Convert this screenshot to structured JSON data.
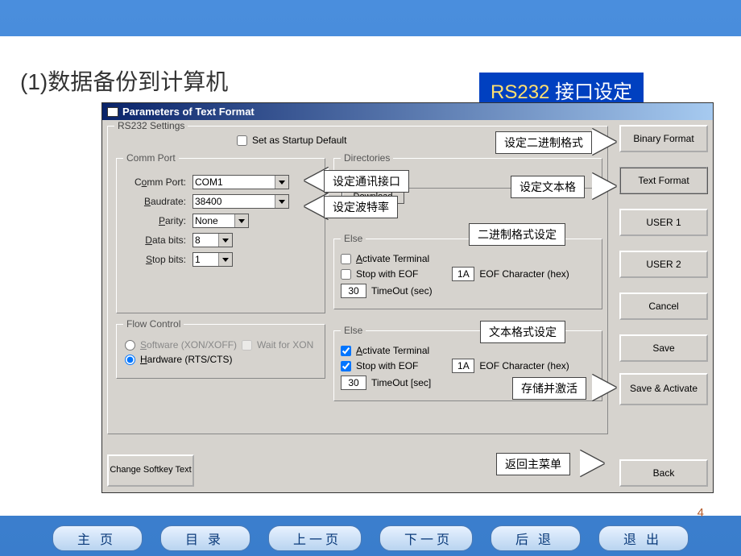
{
  "slide": {
    "title": "(1)数据备份到计算机",
    "badge_prefix": "RS232",
    "badge_suffix": " 接口设定",
    "page_num": "4"
  },
  "dialog": {
    "title": "Parameters of Text Format",
    "startup": "Set  as Startup Default"
  },
  "main_legend": "RS232 Settings",
  "comm": {
    "legend": "Comm Port",
    "port_lbl": "Comm Port:",
    "port": "COM1",
    "baud_lbl": "Baudrate:",
    "baud": "38400",
    "parity_lbl": "Parity:",
    "parity": "None",
    "data_lbl": "Data bits:",
    "data": "8",
    "stop_lbl": "Stop bits:",
    "stop": "1"
  },
  "flow": {
    "legend": "Flow Control",
    "soft": "Software (XON/XOFF)",
    "wait": "Wait for XON",
    "hard": "Hardware (RTS/CTS)"
  },
  "dir": {
    "legend": "Directories",
    "download": "Download"
  },
  "else1": {
    "legend": "Else",
    "act": "Activate Terminal",
    "eof": "Stop with  EOF",
    "hex": "1A",
    "hexlbl": "EOF Character (hex)",
    "to": "30",
    "tolbl": "TimeOut (sec)"
  },
  "else2": {
    "legend": "Else",
    "act": "Activate Terminal",
    "eof": "Stop with  EOF",
    "hex": "1A",
    "hexlbl": "EOF Character (hex)",
    "to": "30",
    "tolbl": "TimeOut [sec]"
  },
  "sidebar": {
    "b1": "Binary Format",
    "b2": "Text Format",
    "b3": "USER 1",
    "b4": "USER 2",
    "b5": "Cancel",
    "b6": "Save",
    "b7": "Save & Activate"
  },
  "bottom": {
    "change": "Change Softkey Text",
    "back": "Back"
  },
  "labels": {
    "bin": "设定二进制格式",
    "txt": "设定文本格",
    "comm": "设定通讯接口",
    "baud": "设定波特率",
    "binset": "二进制格式设定",
    "txtset": "文本格式设定",
    "save": "存储并激活",
    "return": "返回主菜单"
  },
  "nav": {
    "home": "主页",
    "toc": "目录",
    "prev": "上一页",
    "next": "下一页",
    "back": "后退",
    "exit": "退出"
  }
}
